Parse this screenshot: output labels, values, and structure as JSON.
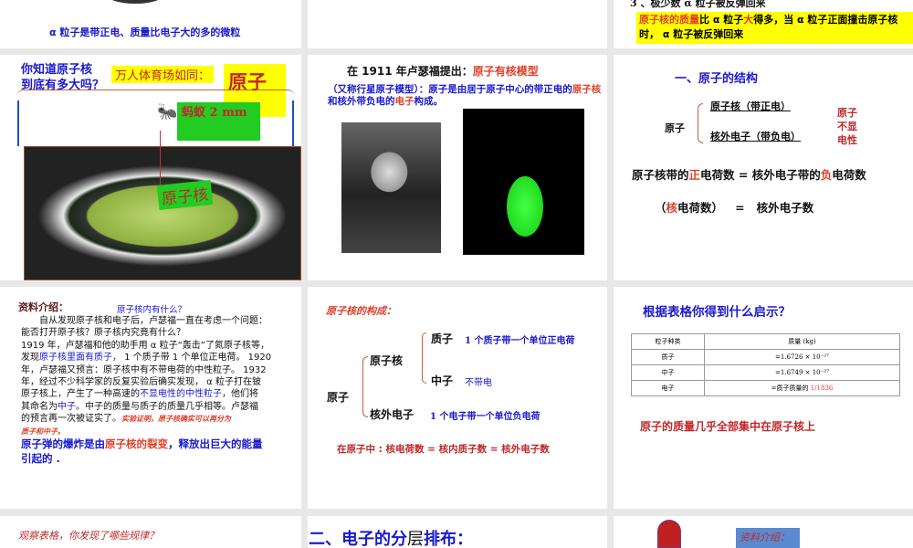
{
  "slides": {
    "s1": {
      "caption": "α 粒子是带正电、质量比电子大的多的微粒"
    },
    "s3": {
      "line3": "3 、极少数 α 粒子被反弹回来",
      "hl_a": "原子核的质量",
      "hl_b": "比 α 粒子",
      "hl_c": "大",
      "hl_d": "得多，当 α 粒子正面撞击原子核时，  α 粒子被反弹回来"
    },
    "s4": {
      "question": [
        "你知道原子核",
        "到底有多大吗？"
      ],
      "stadium_label": "万人体育场如同：",
      "atom": "原子",
      "ant": "蚂蚁  2 mm",
      "nucleus": "原子核"
    },
    "s5": {
      "title_a": "在 1911 年卢瑟福提出：",
      "title_b": "原子有核模型",
      "p_a": "（又称行星原子模型）：原子是由居于原子中心的带正电的",
      "p_b": "原子核",
      "p_c": "和核外带负电的",
      "p_d": "电子",
      "p_e": "构成。"
    },
    "s6": {
      "title": "一、原子的结构",
      "atom": "原子",
      "nucleus": "原子核（带正电）",
      "electron": "核外电子（带负电）",
      "neutral": [
        "原子",
        "不显",
        "电性"
      ],
      "eq1": [
        "原子核带的",
        "正",
        "电荷数 = 核外电子带的",
        "负",
        "电荷数"
      ],
      "eq2": [
        "（",
        "核",
        "电荷数）   =   核外电子数"
      ]
    },
    "s7": {
      "label": "资料介绍：",
      "subtitle": "原子核内有什么？",
      "para": [
        "　　自从发现原子核和电子后，卢瑟福一直在考虑一个问题：",
        "能否打开原子核？原子核内究竟有什么？",
        "1919 年，卢瑟福和他的助手用 α 粒子“轰击”了氮原子核等，"
      ],
      "p4a": "发现",
      "p4b": "原子核里面有质子，",
      "p4c": " 1 个质子带 1 个单位正电荷。 1920",
      "p5": "年，卢瑟福又预言：原子核中有不带电荷的中性粒子。 1932",
      "p6": "年，经过不少科学家的反复实验后确实发现， α 粒子打在铍",
      "p7a": "原子核上，产生了一种高速的",
      "p7b": "不显电性的中性粒子",
      "p7c": "，他们将",
      "p8a": "其命名为",
      "p8b": "中子",
      "p8c": "。中子的质量与质子的质量几乎相等。卢瑟福",
      "p9": "的预言再一次被证实了。",
      "p9red": "实验证明，原子核确实可以再分为",
      "p10": "质子和中子。",
      "bomb_a": "原子弹的爆炸是由",
      "bomb_b": "原子核的裂变",
      "bomb_c": "，释放出巨大的能量",
      "bomb_d": "引起的 ."
    },
    "s8": {
      "title": "原子核的构成：",
      "atom": "原子",
      "nucleus": "原子核",
      "proton": "质子",
      "proton_desc": "1 个质子带一个单位正电荷",
      "neutron": "中子",
      "neutron_desc": "不带电",
      "electron": "核外电子",
      "electron_desc": "1 个电子带一个单位负电荷",
      "summary": "在原子中 : 核电荷数 = 核内质子数 = 核外电子数"
    },
    "s9": {
      "title": "根据表格你得到什么启示？",
      "headers": [
        "粒子种类",
        "质量 (kg)"
      ],
      "rows": [
        [
          "质子",
          "=1.6726 × 10⁻²⁷",
          ""
        ],
        [
          "中子",
          "=1.6749 × 10⁻²⁷",
          ""
        ],
        [
          "电子",
          "=质子质量的 ",
          "1/1836"
        ]
      ],
      "conclusion": "原子的质量几乎全部集中在原子核上"
    },
    "s10": {
      "text": "观察表格，你发现了哪些规律？"
    },
    "s11": {
      "a": "二、电子的分",
      "b": "层",
      "c": "排布："
    },
    "s12": {
      "label": "资料介绍："
    }
  }
}
